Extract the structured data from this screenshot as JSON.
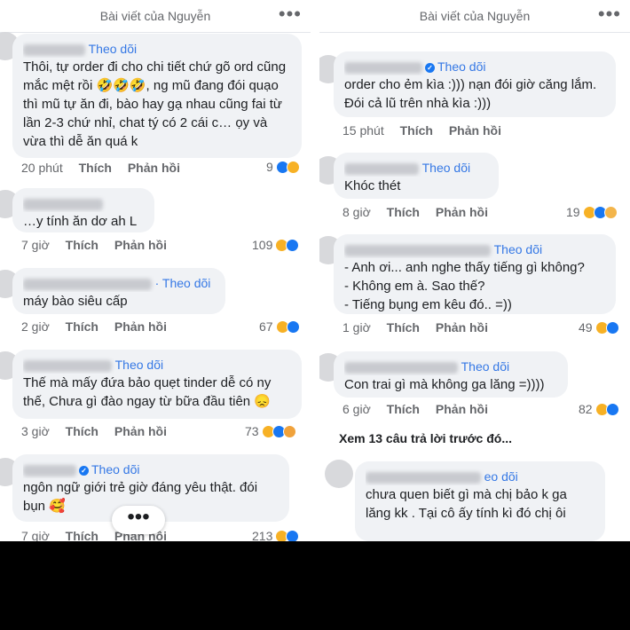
{
  "left": {
    "header_title": "Bài viết của Nguyễn",
    "comments": [
      {
        "name": "Theo dõi",
        "text": "Thôi, tự order đi cho chi tiết chứ gõ ord cũng mắc mệt rồi 🤣🤣🤣, ng mũ đang đói quạo thì mũ tự ăn đi, bào hay gạ nhau cũng fai từ lần 2-3 chứ nhỉ, chat tý có 2 cái c… ọy và vừa thì dễ ăn quá k",
        "time": "20 phút",
        "like": "Thích",
        "reply": "Phản hồi",
        "count": "9"
      },
      {
        "name": "",
        "text": "…y tính ăn dơ ah L",
        "time": "7 giờ",
        "like": "Thích",
        "reply": "Phản hồi",
        "count": "109"
      },
      {
        "name": "· Theo dõi",
        "text": "máy bào siêu cấp",
        "time": "2 giờ",
        "like": "Thích",
        "reply": "Phản hồi",
        "count": "67"
      },
      {
        "name": "Theo dõi",
        "text": "Thế mà mấy đứa bảo quẹt tinder dễ có ny thế, Chưa gì đào ngay từ bữa đầu tiên 😞",
        "time": "3 giờ",
        "like": "Thích",
        "reply": "Phản hồi",
        "count": "73"
      },
      {
        "name": "Theo dõi",
        "text": "ngôn ngữ giới trẻ giờ đáng yêu thật. đói bụn 🥰",
        "time": "7 giờ",
        "like": "Thích",
        "reply": "Phản hồi",
        "count": "213"
      }
    ]
  },
  "right": {
    "header_title": "Bài viết của Nguyễn",
    "comments": [
      {
        "name": "Theo dõi",
        "text": "order cho ẻm kìa :))) nạn đói giờ căng lắm. Đói cả lũ trên nhà kìa :)))",
        "time": "15 phút",
        "like": "Thích",
        "reply": "Phản hồi",
        "count": ""
      },
      {
        "name": "Theo dõi",
        "text": "Khóc thét",
        "time": "8 giờ",
        "like": "Thích",
        "reply": "Phản hồi",
        "count": "19"
      },
      {
        "name": "Theo dõi",
        "text": "- Anh ơi... anh nghe thấy tiếng gì không?\n- Không em à. Sao thế?\n- Tiếng bụng em kêu đó.. =))",
        "time": "1 giờ",
        "like": "Thích",
        "reply": "Phản hồi",
        "count": "49"
      },
      {
        "name": "Theo dõi",
        "text": "Con trai gì mà không ga lăng =))))",
        "time": "6 giờ",
        "like": "Thích",
        "reply": "Phản hồi",
        "count": "82"
      },
      {
        "name": "eo dõi",
        "text": "chưa quen biết gì mà chị bảo k ga lăng kk . Tại cô ấy tính kì đó chị ôi",
        "time": "",
        "like": "",
        "reply": "",
        "count": ""
      }
    ],
    "see_more": "Xem 13 câu trả lời trước đó..."
  },
  "icons": {
    "more": "more-dots-icon",
    "fab": "more-options-icon"
  },
  "colors": {
    "accent": "#3578e5",
    "bubble": "#f0f2f5",
    "muted": "#65676b"
  }
}
